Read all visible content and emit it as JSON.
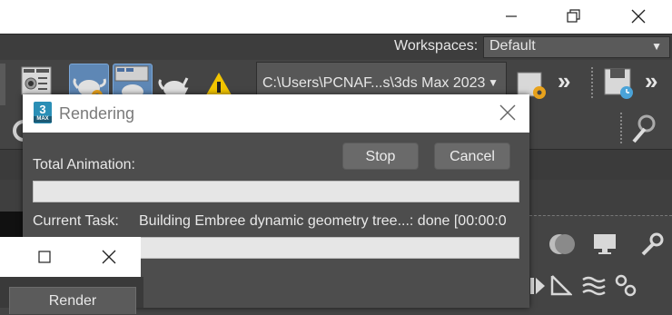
{
  "window_controls": {
    "minimize": "minimize-icon",
    "maximize": "restore-icon",
    "close": "close-icon"
  },
  "workspaces": {
    "label": "Workspaces:",
    "value": "Default"
  },
  "toolbar": {
    "project_path": "C:\\Users\\PCNAF...s\\3ds Max 2023"
  },
  "dialog": {
    "title": "Rendering",
    "stop_label": "Stop",
    "cancel_label": "Cancel",
    "total_label": "Total Animation:",
    "total_progress": 0,
    "current_task_label": "Current Task:",
    "current_task_value": "Building Embree dynamic geometry tree...: done [00:00:0",
    "current_progress": 0
  },
  "render_window": {
    "render_label": "Render"
  },
  "colors": {
    "dark_bg": "#444444",
    "active_button": "#5e87b5",
    "dialog_bg": "#4d4d4d"
  }
}
